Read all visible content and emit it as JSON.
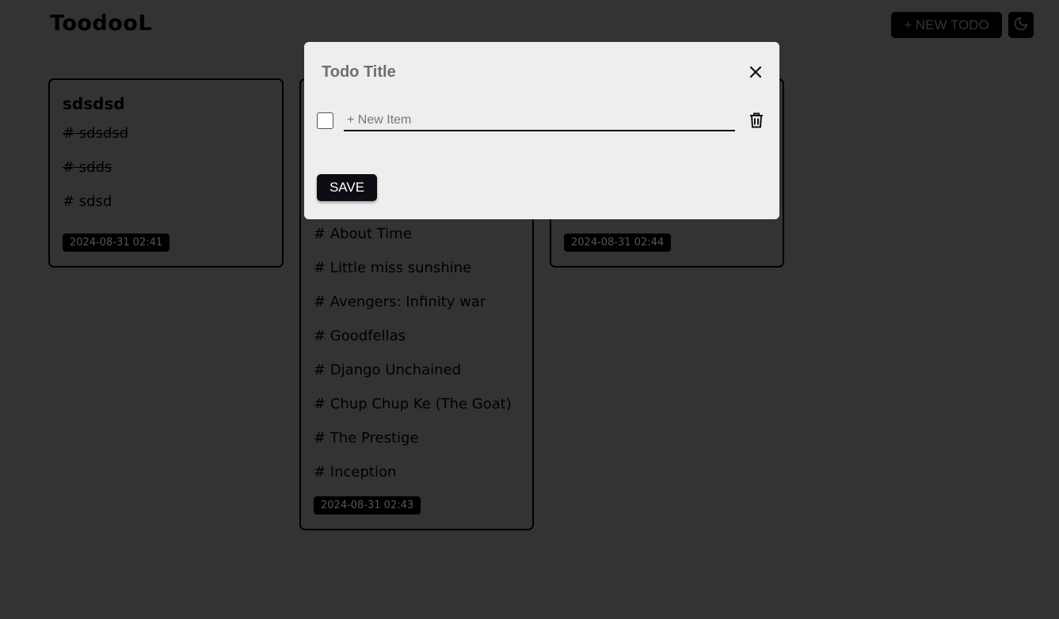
{
  "app": {
    "logo": "ToodooL",
    "new_todo_label": "+ NEW TODO",
    "theme_toggle_icon": "moon-icon"
  },
  "cards": [
    {
      "title": "sdsdsd",
      "items": [
        {
          "text": "# sdsdsd",
          "done": true
        },
        {
          "text": "# sdds",
          "done": true
        },
        {
          "text": "# sdsd",
          "done": false
        }
      ],
      "date": "2024-08-31 02:41"
    },
    {
      "title": "",
      "items": [
        {
          "text": "# About Time",
          "done": false
        },
        {
          "text": "# Little miss sunshine",
          "done": false
        },
        {
          "text": "# Avengers: Infinity war",
          "done": false
        },
        {
          "text": "# Goodfellas",
          "done": false
        },
        {
          "text": "# Django Unchained",
          "done": false
        },
        {
          "text": "# Chup Chup Ke (The Goat)",
          "done": false
        },
        {
          "text": "# The Prestige",
          "done": false
        },
        {
          "text": "# Inception",
          "done": false
        }
      ],
      "date": "2024-08-31 02:43"
    },
    {
      "title": "",
      "items": [],
      "date": "2024-08-31 02:44"
    }
  ],
  "modal": {
    "title": "Todo Title",
    "close_icon": "close-icon",
    "new_item_placeholder": "+ New Item",
    "new_item_value": "",
    "checkbox_checked": false,
    "delete_icon": "trash-icon",
    "save_label": "SAVE"
  },
  "colors": {
    "background": "#333333",
    "modal_background": "#eeeeee",
    "button_dark": "#000000"
  }
}
